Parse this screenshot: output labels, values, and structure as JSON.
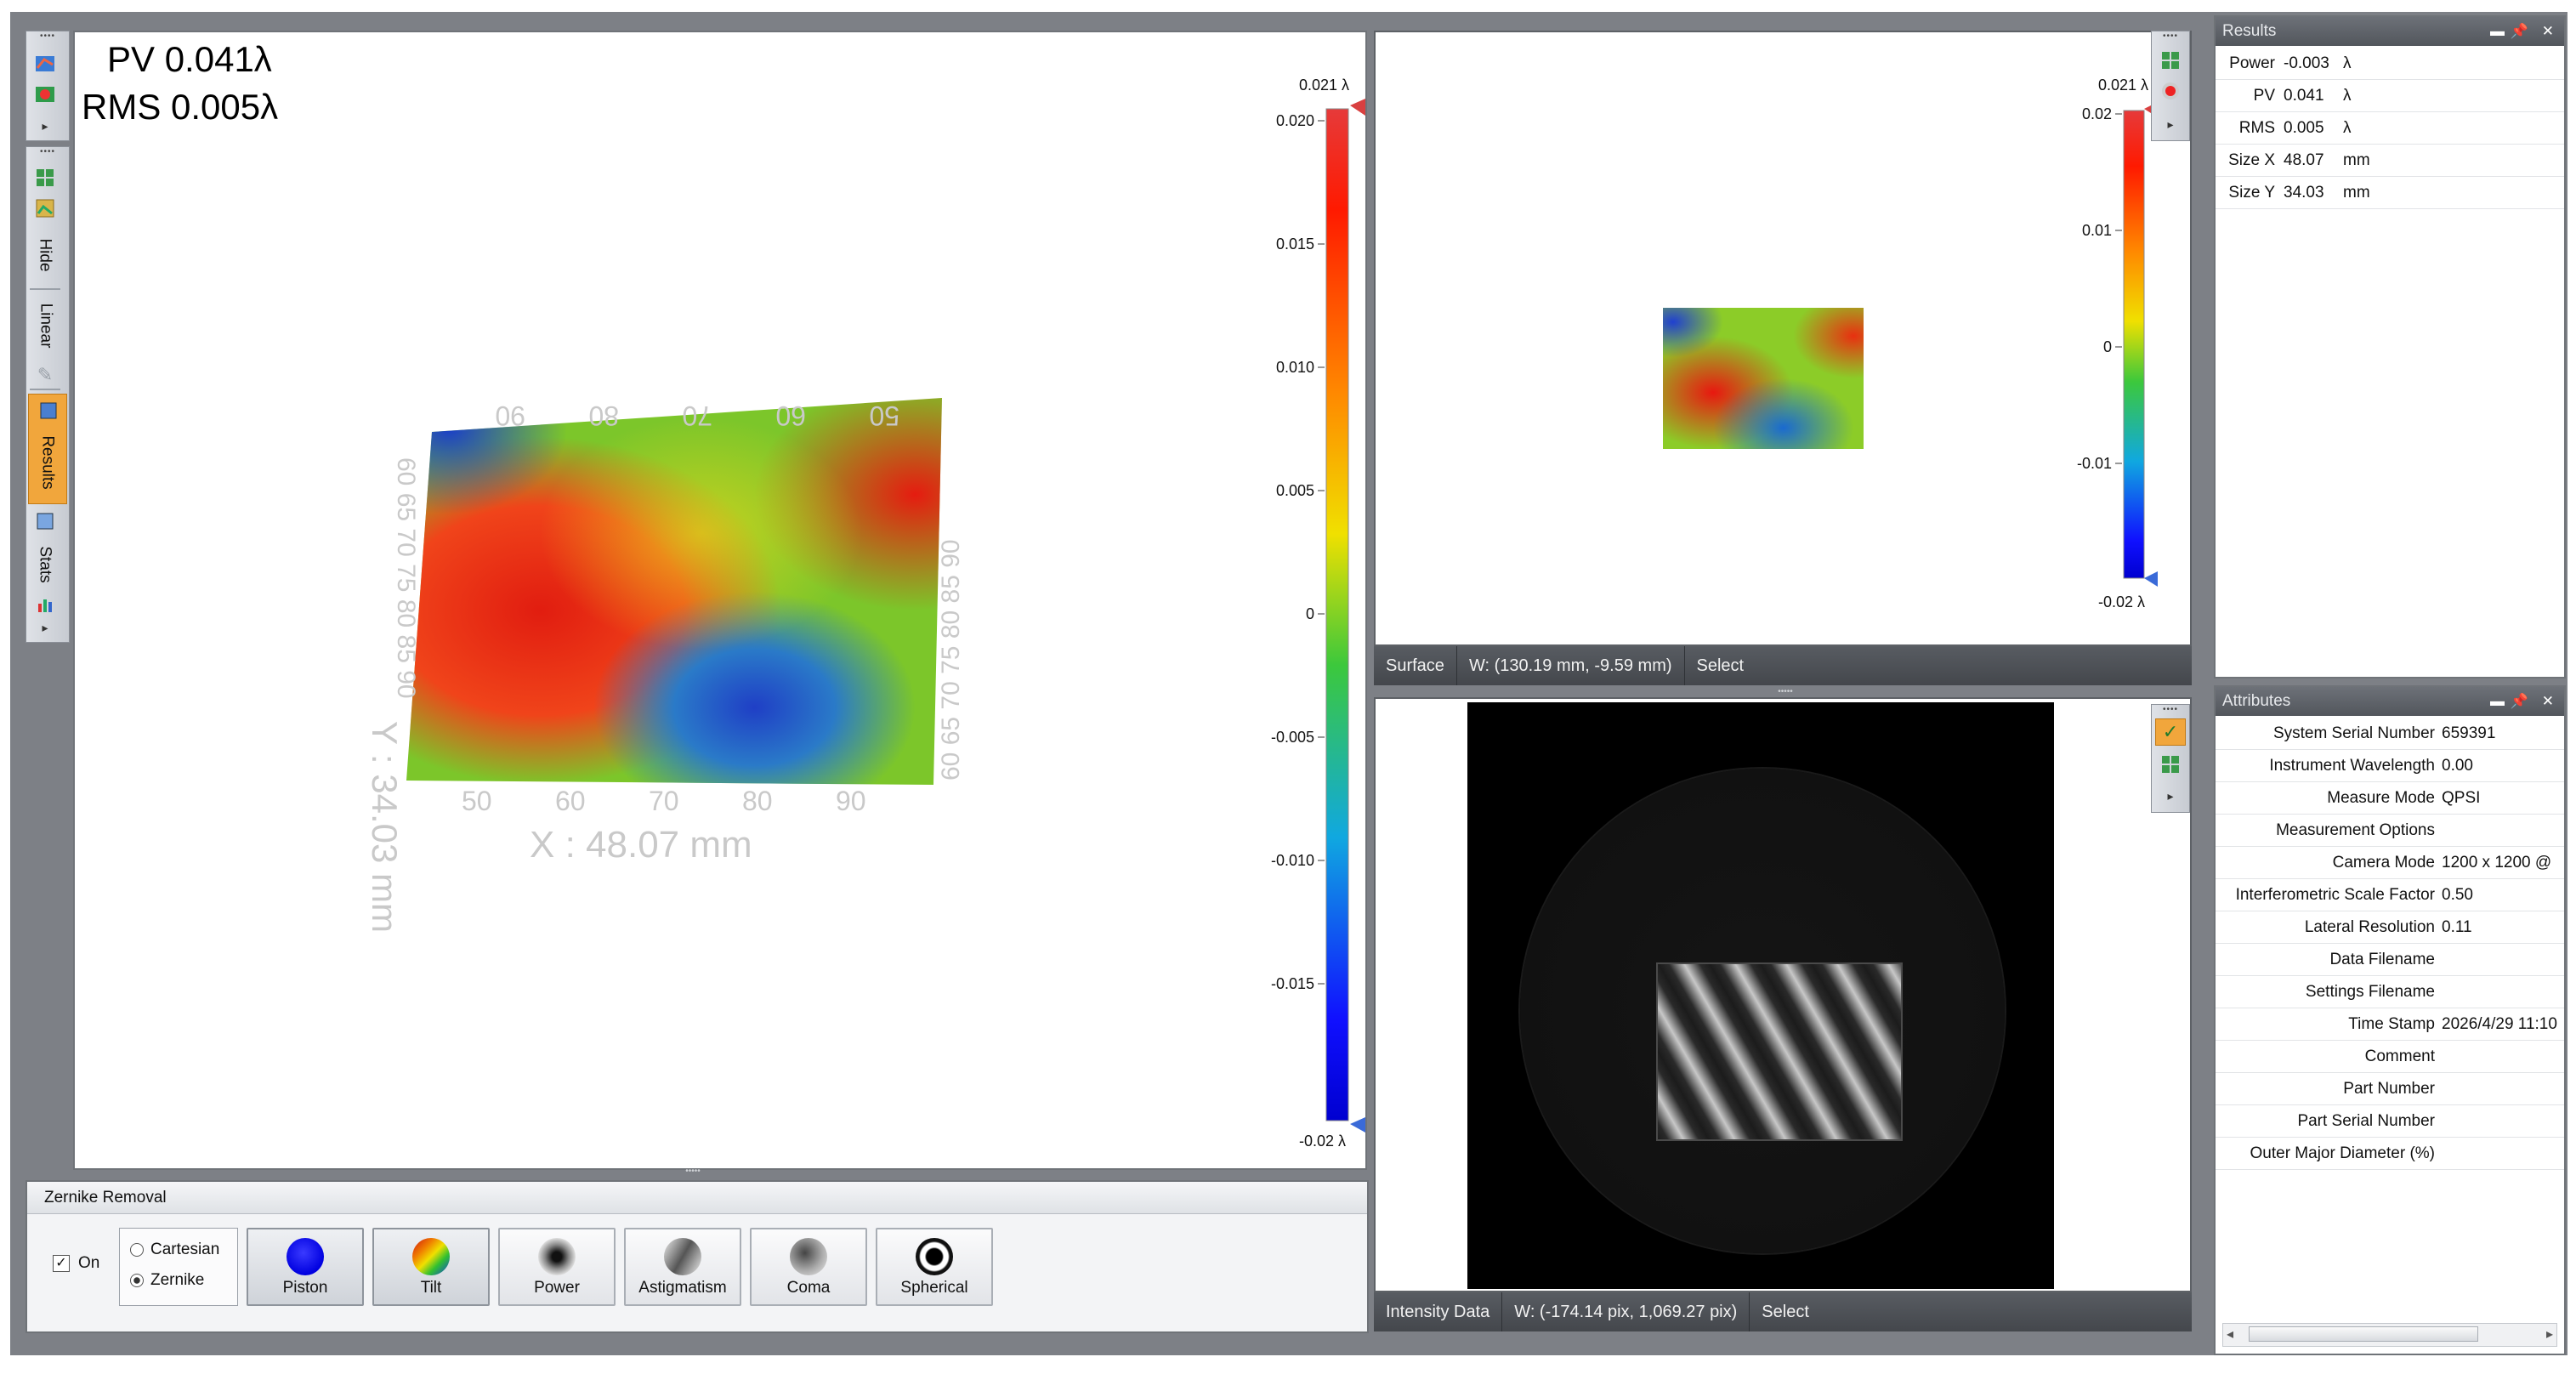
{
  "main_view": {
    "pv_label": "PV 0.041λ",
    "rms_label": "RMS 0.005λ",
    "x_axis_title": "X : 48.07 mm",
    "y_axis_title": "Y : 34.03 mm",
    "x_ticks": [
      "50",
      "60",
      "70",
      "80",
      "90"
    ],
    "top_ticks": [
      "90",
      "80",
      "70",
      "60",
      "50"
    ],
    "y_ticks": "60 65 70 75 80 85 90",
    "right_ticks": "60 65 70 75 80 85 90",
    "colorbar_top": "0.021 λ",
    "colorbar_bottom": "-0.02 λ",
    "colorbar_ticks": [
      "0.020",
      "0.015",
      "0.010",
      "0.005",
      "0",
      "-0.005",
      "-0.010",
      "-0.015"
    ]
  },
  "left_toolbar": {
    "hide_label": "Hide",
    "linear_label": "Linear",
    "results_label": "Results",
    "stats_label": "Stats"
  },
  "surface_view": {
    "colorbar_top": "0.021 λ",
    "colorbar_bottom": "-0.02 λ",
    "colorbar_ticks": [
      "0.02",
      "0.01",
      "0",
      "-0.01"
    ],
    "status": {
      "mode": "Surface",
      "coords": "W: (130.19 mm, -9.59 mm)",
      "tool": "Select"
    }
  },
  "intensity_view": {
    "status": {
      "mode": "Intensity Data",
      "coords": "W: (-174.14 pix, 1,069.27 pix)",
      "tool": "Select"
    }
  },
  "zernike": {
    "title": "Zernike Removal",
    "on_label": "On",
    "on_checked": true,
    "cartesian_label": "Cartesian",
    "zernike_label": "Zernike",
    "buttons": [
      {
        "label": "Piston",
        "icon": "piston-icon",
        "selected": true
      },
      {
        "label": "Tilt",
        "icon": "tilt-icon",
        "selected": true
      },
      {
        "label": "Power",
        "icon": "power-icon",
        "selected": false
      },
      {
        "label": "Astigmatism",
        "icon": "astigmatism-icon",
        "selected": false
      },
      {
        "label": "Coma",
        "icon": "coma-icon",
        "selected": false
      },
      {
        "label": "Spherical",
        "icon": "spherical-icon",
        "selected": false
      }
    ]
  },
  "results": {
    "title": "Results",
    "rows": [
      {
        "key": "Power",
        "value": "-0.003",
        "unit": "λ"
      },
      {
        "key": "PV",
        "value": "0.041",
        "unit": "λ"
      },
      {
        "key": "RMS",
        "value": "0.005",
        "unit": "λ"
      },
      {
        "key": "Size X",
        "value": "48.07",
        "unit": "mm"
      },
      {
        "key": "Size Y",
        "value": "34.03",
        "unit": "mm"
      }
    ]
  },
  "attributes": {
    "title": "Attributes",
    "rows": [
      {
        "key": "System Serial Number",
        "value": "659391"
      },
      {
        "key": "Instrument Wavelength",
        "value": "0.00"
      },
      {
        "key": "Measure Mode",
        "value": "QPSI"
      },
      {
        "key": "Measurement Options",
        "value": ""
      },
      {
        "key": "Camera Mode",
        "value": "1200 x 1200 @"
      },
      {
        "key": "Interferometric Scale Factor",
        "value": "0.50"
      },
      {
        "key": "Lateral Resolution",
        "value": "0.11"
      },
      {
        "key": "Data Filename",
        "value": ""
      },
      {
        "key": "Settings Filename",
        "value": ""
      },
      {
        "key": "Time Stamp",
        "value": "2026/4/29 11:10"
      },
      {
        "key": "Comment",
        "value": ""
      },
      {
        "key": "Part Number",
        "value": ""
      },
      {
        "key": "Part Serial Number",
        "value": ""
      },
      {
        "key": "Outer Major Diameter (%)",
        "value": ""
      }
    ]
  },
  "colors": {
    "frame": "#7d8086",
    "statusbar": "#4c5055",
    "sidehead": "#5f6369",
    "highlight_tab": "#f1a63c"
  }
}
